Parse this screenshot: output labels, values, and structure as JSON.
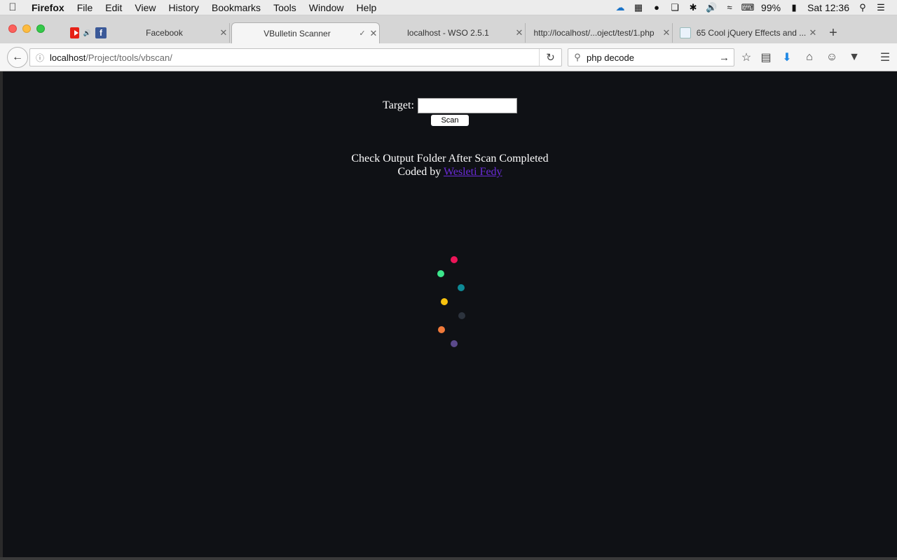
{
  "menubar": {
    "app_name": "Firefox",
    "items": [
      "File",
      "Edit",
      "View",
      "History",
      "Bookmarks",
      "Tools",
      "Window",
      "Help"
    ],
    "battery": "99%",
    "clock": "Sat 12:36"
  },
  "tabs": [
    {
      "label": "Facebook",
      "favicon": "facebook-icon"
    },
    {
      "label": "VBulletin Scanner",
      "favicon": "none",
      "active": true
    },
    {
      "label": "localhost - WSO 2.5.1",
      "favicon": "none"
    },
    {
      "label": "http://localhost/...oject/test/1.php",
      "favicon": "none"
    },
    {
      "label": "65 Cool jQuery Effects and ...",
      "favicon": "page-icon"
    }
  ],
  "navbar": {
    "url_host": "localhost",
    "url_path": "/Project/tools/vbscan/",
    "search_value": "php decode"
  },
  "page": {
    "target_label": "Target:",
    "target_value": "",
    "scan_button": "Scan",
    "notice": "Check Output Folder After Scan Completed",
    "coded_by": "Coded by",
    "author_link": "Wesleti Fedy",
    "background_color": "#0f1115",
    "loader_colors": [
      "#ec1558",
      "#3ce68c",
      "#0e8a96",
      "#f7c20e",
      "#2c333d",
      "#f07a3a",
      "#5b4a8c"
    ]
  }
}
